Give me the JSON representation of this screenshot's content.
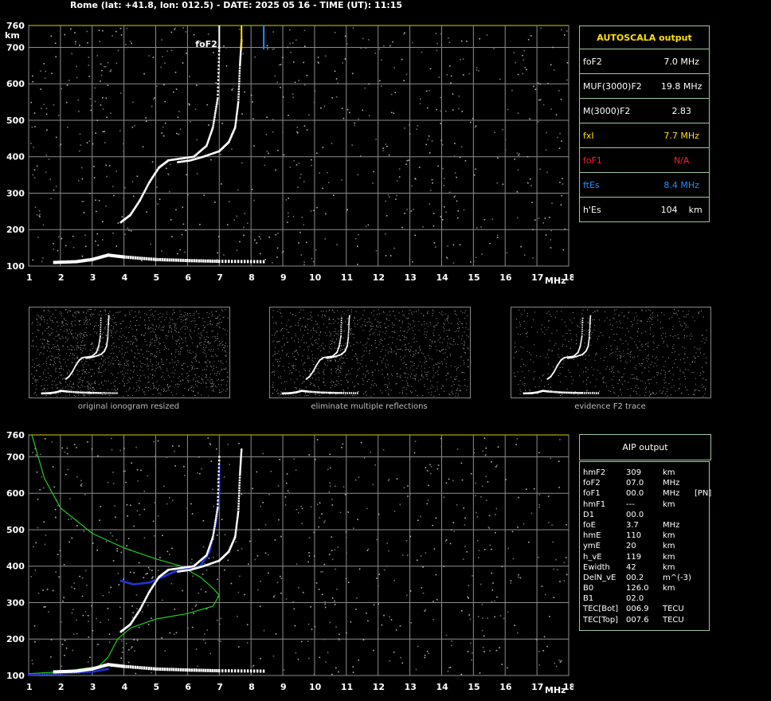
{
  "header": "Rome (lat: +41.8, lon: 012.5) - DATE: 2025 05 16 - TIME (UT): 11:15",
  "colors": {
    "grid": "#8c8c8c",
    "frame": "#d8d000",
    "trace": "#ffffff",
    "model": "#22cc22",
    "fit": "#2233dd",
    "foF2_marker": "#ffffff",
    "fxI_marker": "#ffe000",
    "ftEs_marker": "#1e90ff"
  },
  "chart_data": [
    {
      "type": "scatter",
      "title": "",
      "xlabel": "MHz",
      "ylabel": "km",
      "xlim": [
        1,
        18
      ],
      "ylim": [
        100,
        760
      ],
      "x_ticks": [
        "1",
        "2",
        "3",
        "4",
        "5",
        "6",
        "7",
        "8",
        "9",
        "10",
        "11",
        "12",
        "13",
        "14",
        "15",
        "16",
        "17",
        "18"
      ],
      "y_ticks": [
        "100",
        "200",
        "300",
        "400",
        "500",
        "600",
        "700",
        "760"
      ],
      "annotations": [
        "foF2"
      ],
      "markers": {
        "foF2": 7.0,
        "fxI": 7.7,
        "ftEs": 8.4
      },
      "series": [
        {
          "values": [
            [
              3.9,
              220
            ],
            [
              4.2,
              240
            ],
            [
              4.5,
              280
            ],
            [
              4.8,
              330
            ],
            [
              5.1,
              370
            ],
            [
              5.4,
              390
            ],
            [
              5.8,
              395
            ],
            [
              6.2,
              400
            ],
            [
              6.6,
              430
            ],
            [
              6.8,
              480
            ],
            [
              6.95,
              560
            ],
            [
              7.0,
              700
            ]
          ]
        },
        {
          "values": [
            [
              5.7,
              385
            ],
            [
              6.1,
              390
            ],
            [
              6.5,
              400
            ],
            [
              7.0,
              415
            ],
            [
              7.3,
              440
            ],
            [
              7.5,
              480
            ],
            [
              7.6,
              550
            ],
            [
              7.65,
              650
            ],
            [
              7.7,
              720
            ]
          ]
        },
        {
          "values": [
            [
              1.8,
              110
            ],
            [
              2.5,
              112
            ],
            [
              3.0,
              118
            ],
            [
              3.5,
              130
            ],
            [
              4.0,
              125
            ],
            [
              5.0,
              118
            ],
            [
              6.0,
              115
            ],
            [
              7.0,
              113
            ],
            [
              8.4,
              112
            ]
          ]
        }
      ]
    },
    {
      "type": "scatter",
      "title": "",
      "xlabel": "MHz",
      "ylabel": "km",
      "xlim": [
        1,
        18
      ],
      "ylim": [
        100,
        760
      ],
      "x_ticks": [
        "1",
        "2",
        "3",
        "4",
        "5",
        "6",
        "7",
        "8",
        "9",
        "10",
        "11",
        "12",
        "13",
        "14",
        "15",
        "16",
        "17",
        "18"
      ],
      "y_ticks": [
        "100",
        "200",
        "300",
        "400",
        "500",
        "600",
        "700",
        "760"
      ],
      "series": [
        {
          "values": [
            [
              1.1,
              760
            ],
            [
              1.5,
              640
            ],
            [
              2.0,
              560
            ],
            [
              3.0,
              490
            ],
            [
              4.0,
              450
            ],
            [
              5.0,
              420
            ],
            [
              5.8,
              400
            ],
            [
              6.4,
              370
            ],
            [
              6.8,
              340
            ],
            [
              7.0,
              320
            ],
            [
              6.8,
              290
            ],
            [
              6.0,
              270
            ],
            [
              5.0,
              255
            ],
            [
              4.2,
              230
            ],
            [
              3.8,
              200
            ],
            [
              3.5,
              150
            ],
            [
              3.2,
              125
            ],
            [
              2.0,
              110
            ],
            [
              1.0,
              105
            ]
          ]
        },
        {
          "values": [
            [
              3.9,
              360
            ],
            [
              4.3,
              350
            ],
            [
              4.8,
              355
            ],
            [
              5.2,
              370
            ],
            [
              5.6,
              385
            ],
            [
              6.0,
              395
            ],
            [
              6.4,
              400
            ],
            [
              6.7,
              440
            ],
            [
              6.9,
              520
            ],
            [
              7.0,
              600
            ],
            [
              7.0,
              680
            ]
          ]
        },
        {
          "values": [
            [
              1.0,
              102
            ],
            [
              2.0,
              105
            ],
            [
              3.0,
              110
            ],
            [
              3.5,
              118
            ]
          ]
        },
        {
          "values": [
            [
              3.9,
              220
            ],
            [
              4.2,
              240
            ],
            [
              4.5,
              280
            ],
            [
              4.8,
              330
            ],
            [
              5.1,
              370
            ],
            [
              5.4,
              390
            ],
            [
              5.8,
              395
            ],
            [
              6.2,
              400
            ],
            [
              6.6,
              430
            ],
            [
              6.8,
              480
            ],
            [
              6.95,
              560
            ],
            [
              7.0,
              700
            ]
          ]
        },
        {
          "values": [
            [
              5.7,
              385
            ],
            [
              6.1,
              390
            ],
            [
              6.5,
              400
            ],
            [
              7.0,
              415
            ],
            [
              7.3,
              440
            ],
            [
              7.5,
              480
            ],
            [
              7.6,
              550
            ],
            [
              7.65,
              650
            ],
            [
              7.7,
              720
            ]
          ]
        },
        {
          "values": [
            [
              1.8,
              110
            ],
            [
              2.5,
              112
            ],
            [
              3.0,
              118
            ],
            [
              3.5,
              130
            ],
            [
              4.0,
              125
            ],
            [
              5.0,
              118
            ],
            [
              6.0,
              115
            ],
            [
              7.0,
              113
            ],
            [
              8.4,
              112
            ]
          ]
        }
      ]
    }
  ],
  "thumbnails": [
    "original ionogram resized",
    "eliminate multiple reflections",
    "evidence F2 trace"
  ],
  "autoscala": {
    "title": "AUTOSCALA output",
    "rows": [
      {
        "label": "foF2",
        "value": "7.0 MHz",
        "color": "#ffffff"
      },
      {
        "label": "MUF(3000)F2",
        "value": "19.8 MHz",
        "color": "#ffffff"
      },
      {
        "label": "M(3000)F2",
        "value": "2.83",
        "color": "#ffffff"
      },
      {
        "label": "fxI",
        "value": "7.7 MHz",
        "color": "#ffe000"
      },
      {
        "label": "foF1",
        "value": "N/A",
        "color": "#ff2020"
      },
      {
        "label": "ftEs",
        "value": "8.4 MHz",
        "color": "#1e90ff"
      },
      {
        "label": "h'Es",
        "value": "104    km",
        "color": "#ffffff"
      }
    ]
  },
  "aip": {
    "title": "AIP output",
    "rows": [
      [
        "hmF2",
        "309",
        "km",
        ""
      ],
      [
        "foF2",
        "07.0",
        "MHz",
        ""
      ],
      [
        "foF1",
        "00.0",
        "MHz",
        "[PN]"
      ],
      [
        "hmF1",
        "---",
        "km",
        ""
      ],
      [
        "D1",
        "00.0",
        "",
        ""
      ],
      [
        "foE",
        "3.7",
        "MHz",
        ""
      ],
      [
        "hmE",
        "110",
        "km",
        ""
      ],
      [
        "ymE",
        "20",
        "km",
        ""
      ],
      [
        "h_vE",
        "119",
        "km",
        ""
      ],
      [
        "Ewidth",
        "42",
        "km",
        ""
      ],
      [
        "DelN_vE",
        "00.2",
        "m^(-3)",
        ""
      ],
      [
        "B0",
        "126.0",
        "km",
        ""
      ],
      [
        "B1",
        "02.0",
        "",
        ""
      ],
      [
        "TEC[Bot]",
        "006.9",
        "TECU",
        ""
      ],
      [
        "TEC[Top]",
        "007.6",
        "TECU",
        ""
      ]
    ]
  }
}
